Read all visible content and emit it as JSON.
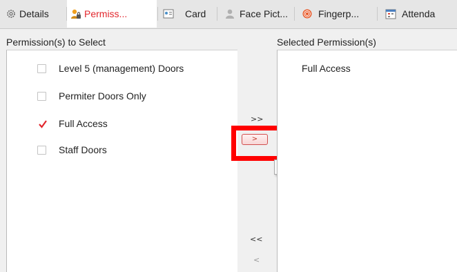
{
  "tabs": [
    {
      "label": "Details",
      "icon": "gear-icon",
      "active": false
    },
    {
      "label": "Permiss...",
      "icon": "user-lock-icon",
      "active": true
    },
    {
      "label": "Card",
      "icon": "card-icon",
      "active": false
    },
    {
      "label": "Face Pict...",
      "icon": "person-icon",
      "active": false
    },
    {
      "label": "Fingerp...",
      "icon": "fingerprint-icon",
      "active": false
    },
    {
      "label": "Attenda",
      "icon": "calendar-icon",
      "active": false
    }
  ],
  "left_panel": {
    "heading": "Permission(s) to Select",
    "items": [
      {
        "label": "Level 5 (management) Doors",
        "checked": false
      },
      {
        "label": "Permiter Doors Only",
        "checked": false
      },
      {
        "label": "Full Access",
        "checked": true
      },
      {
        "label": "Staff Doors",
        "checked": false
      }
    ]
  },
  "right_panel": {
    "heading": "Selected Permission(s)",
    "items": [
      "Full Access"
    ]
  },
  "controls": {
    "add_all": ">>",
    "add_selected": ">",
    "remove_all": "<<",
    "remove_selected": "<",
    "tooltip": ">"
  },
  "colors": {
    "active_tab_text": "#e2262c",
    "highlight_box": "#ff0000",
    "checkmark": "#e2262c"
  }
}
